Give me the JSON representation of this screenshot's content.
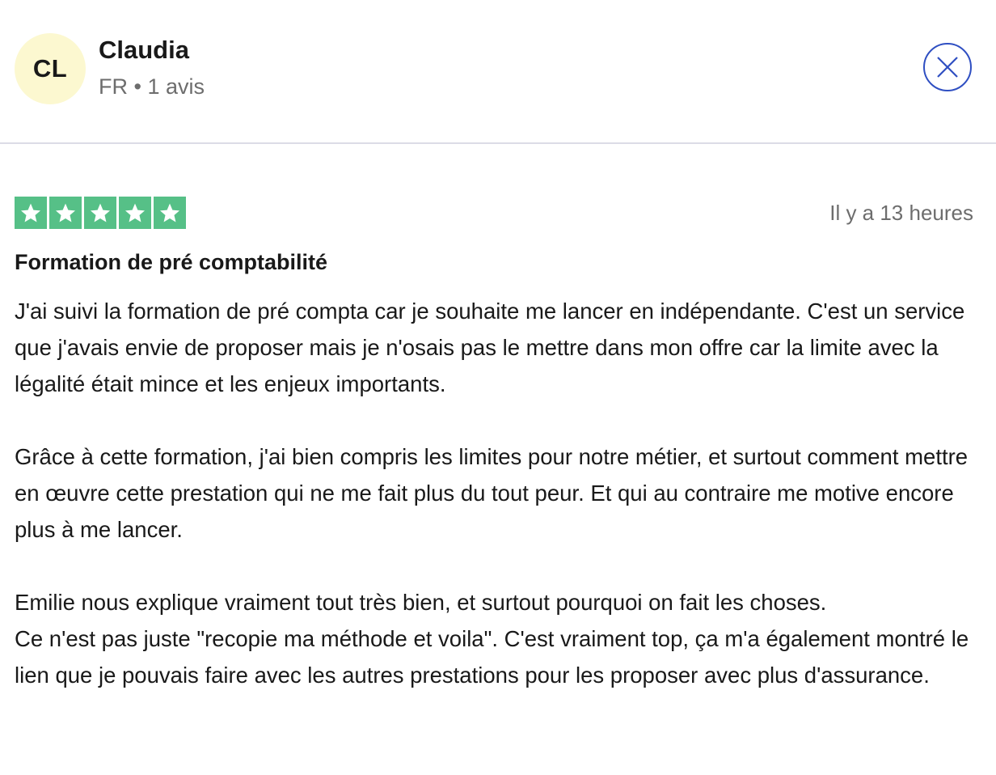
{
  "reviewer": {
    "initials": "CL",
    "name": "Claudia",
    "meta": "FR • 1 avis",
    "avatar_color": "#fcf8d0"
  },
  "close_button": {
    "icon": "close-icon",
    "color": "#2f4fc2"
  },
  "rating": {
    "stars": 5,
    "max": 5,
    "color": "#56c087"
  },
  "review": {
    "date": "Il y a 13 heures",
    "title": "Formation de pré comptabilité",
    "paragraphs": [
      "J'ai suivi la formation de pré compta car je souhaite me lancer en indépendante. C'est un service que j'avais envie de proposer mais je n'osais pas le mettre dans mon offre car la limite avec la légalité était mince et les enjeux importants.",
      "Grâce à cette formation, j'ai bien compris les limites pour notre métier, et surtout comment mettre en œuvre cette prestation qui ne me fait plus du tout peur. Et qui au contraire me motive encore plus à me lancer.",
      "Emilie nous explique vraiment tout très bien, et surtout pourquoi on fait les choses.",
      "Ce n'est pas juste \"recopie ma méthode et voila\". C'est vraiment top, ça m'a également montré le lien que je pouvais faire avec les autres prestations pour les proposer avec plus d'assurance."
    ]
  }
}
